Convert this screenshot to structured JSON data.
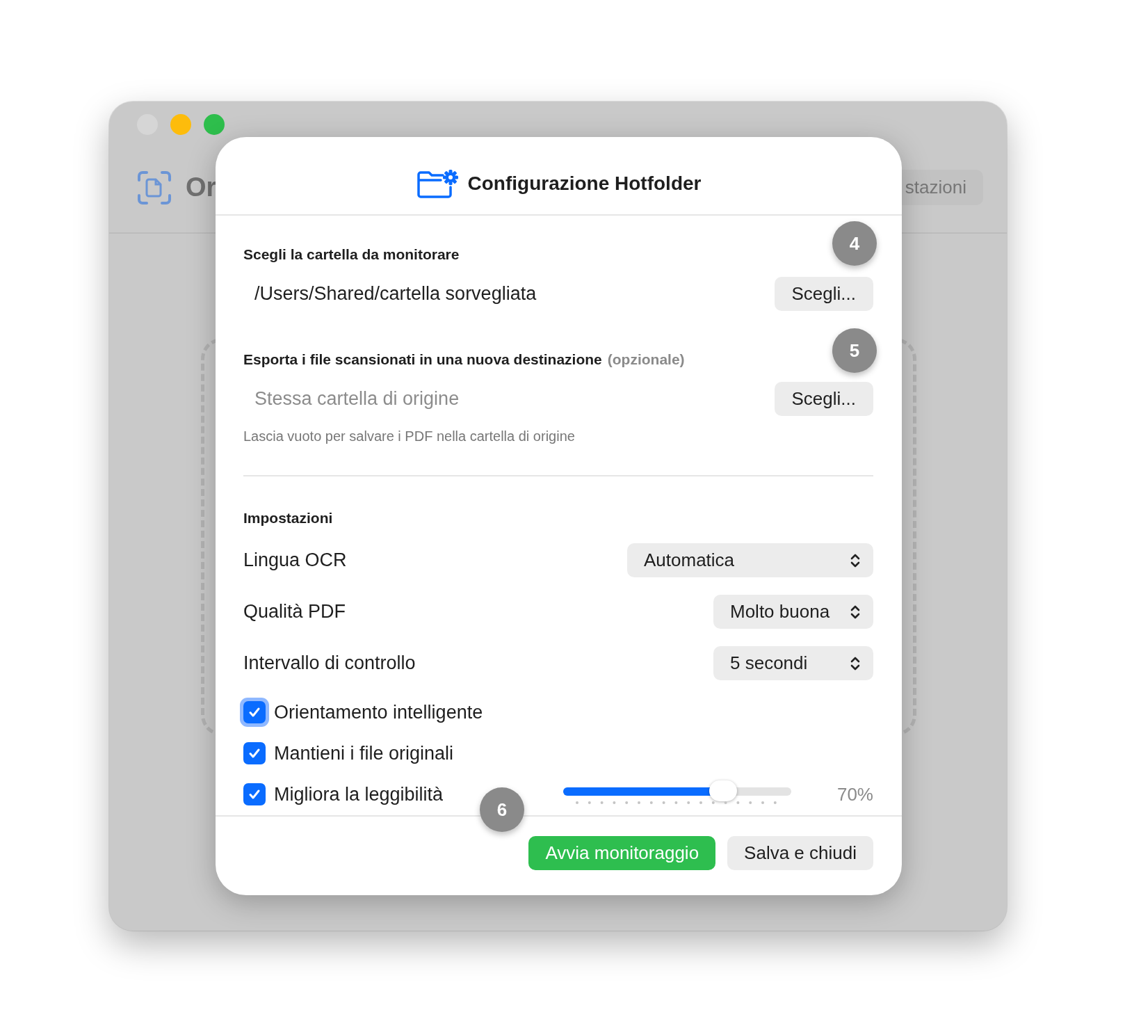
{
  "background_window": {
    "app_title": "Or",
    "toolbar_button": "stazioni"
  },
  "sheet": {
    "title": "Configurazione Hotfolder",
    "source": {
      "label": "Scegli la cartella da monitorare",
      "value": "/Users/Shared/cartella sorvegliata",
      "button": "Scegli..."
    },
    "destination": {
      "label": "Esporta i file scansionati in una nuova destinazione",
      "optional": "(opzionale)",
      "placeholder": "Stessa cartella di origine",
      "button": "Scegli...",
      "hint": "Lascia vuoto per salvare i PDF nella cartella di origine"
    },
    "settings": {
      "heading": "Impostazioni",
      "rows": [
        {
          "kind": "popup",
          "label": "Lingua OCR",
          "value": "Automatica"
        },
        {
          "kind": "popup",
          "label": "Qualità PDF",
          "value": "Molto buona"
        },
        {
          "kind": "popup",
          "label": "Intervallo di controllo",
          "value": "5 secondi"
        },
        {
          "kind": "checkbox",
          "label": "Orientamento intelligente",
          "checked": true,
          "focused": true
        },
        {
          "kind": "checkbox",
          "label": "Mantieni i file originali",
          "checked": true,
          "focused": false
        },
        {
          "kind": "slider",
          "label": "Migliora la leggibilità",
          "checked": true,
          "focused": false,
          "level": 0.7,
          "reading": "70%"
        }
      ]
    },
    "buttons": [
      {
        "label": "Avvia monitoraggio",
        "kind": "primary"
      },
      {
        "label": "Salva e chiudi",
        "kind": "secondary"
      }
    ]
  },
  "badges": [
    "4",
    "5",
    "6"
  ]
}
